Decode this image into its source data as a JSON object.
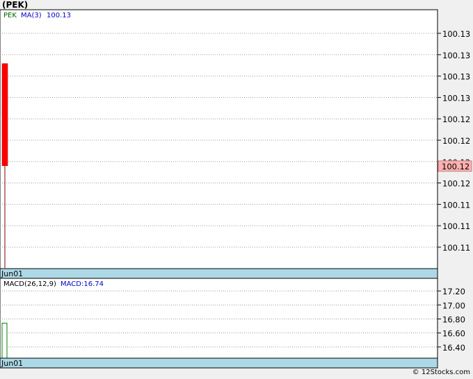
{
  "title": "(PEK)",
  "watermark": "© 12Stocks.com",
  "chart_data": [
    {
      "type": "candlestick",
      "legend": {
        "symbol": "PEK",
        "ma_label": "MA(3)",
        "ma_value": "100.13"
      },
      "y_tick_labels": [
        "100.13",
        "100.13",
        "100.13",
        "100.13",
        "100.12",
        "100.12",
        "100.12",
        "100.12",
        "100.11",
        "100.11",
        "100.11"
      ],
      "ylim": [
        100.11,
        100.135
      ],
      "date_label": "Jun01",
      "last_price_tag": "100.12",
      "candles": [
        {
          "date": "Jun01",
          "open": 100.13,
          "close": 100.12,
          "high": 100.13,
          "low": 100.11
        }
      ],
      "grid": true,
      "colors": {
        "down": "#ff0000",
        "tag_bg": "#ffb0b0",
        "date_band": "#add8e6",
        "symbol": "#006400",
        "ma": "#0000cc"
      }
    },
    {
      "type": "bar",
      "legend": {
        "label": "MACD(26,12,9)",
        "macd_label": "MACD:16.74"
      },
      "y_tick_labels": [
        "17.20",
        "17.00",
        "16.80",
        "16.60",
        "16.40"
      ],
      "yticks": [
        17.2,
        17.0,
        16.8,
        16.6,
        16.4
      ],
      "ylim": [
        16.24,
        17.38
      ],
      "date_label": "Jun01",
      "bars": [
        {
          "date": "Jun01",
          "value": 16.74
        }
      ],
      "grid": true,
      "colors": {
        "bar": "#008000",
        "macd": "#0000cc"
      }
    }
  ]
}
